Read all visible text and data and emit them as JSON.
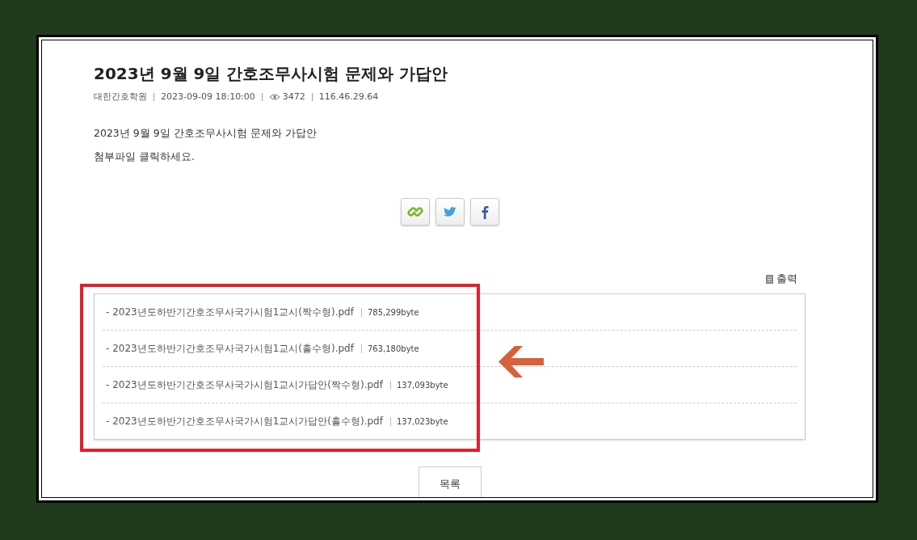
{
  "post": {
    "title": "2023년 9월 9일 간호조무사시험 문제와 가답안",
    "meta": {
      "author": "대한간호학원",
      "datetime": "2023-09-09 18:10:00",
      "views": "3472",
      "ip": "116.46.29.64"
    },
    "body": [
      "2023년 9월 9일 간호조무사시험 문제와 가답안",
      "첨부파일 클릭하세요."
    ],
    "share_buttons": [
      {
        "kind": "link"
      },
      {
        "kind": "twitter"
      },
      {
        "kind": "facebook"
      }
    ],
    "print_label": "출력",
    "attachments": [
      {
        "name": "- 2023년도하반기간호조무사국가시험1교시(짝수형).pdf",
        "size": "785,299byte"
      },
      {
        "name": "- 2023년도하반기간호조무사국가시험1교시(홀수형).pdf",
        "size": "763,180byte"
      },
      {
        "name": "- 2023년도하반기간호조무사국가시험1교시가답안(짝수형).pdf",
        "size": "137,093byte"
      },
      {
        "name": "- 2023년도하반기간호조무사국가시험1교시가답안(홀수형).pdf",
        "size": "137,023byte"
      }
    ],
    "list_button": "목록"
  }
}
